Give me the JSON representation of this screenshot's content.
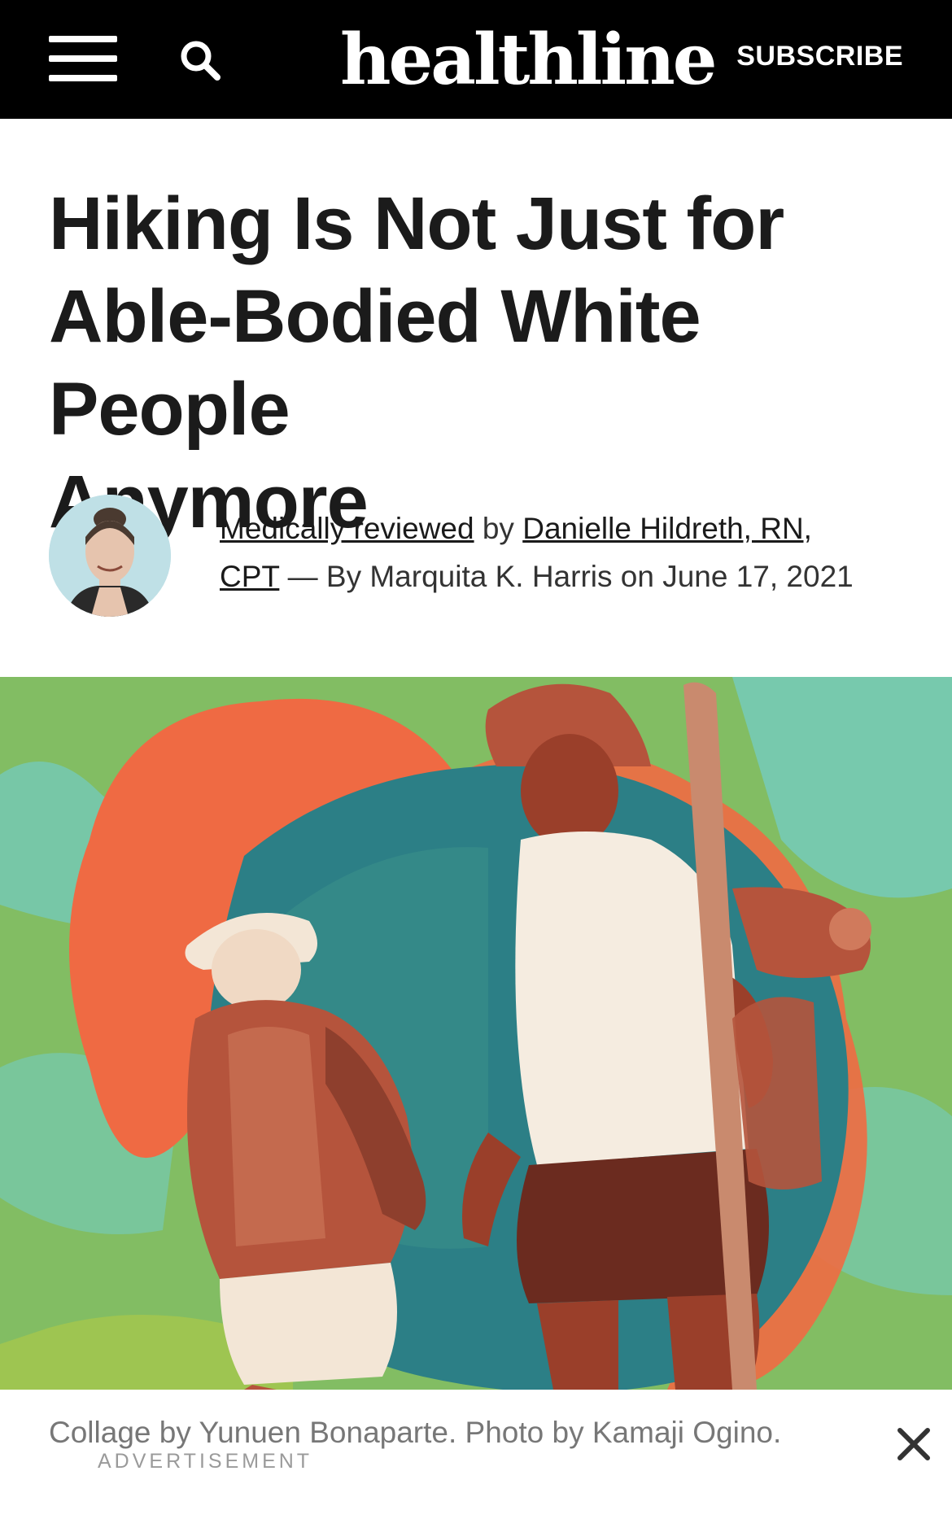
{
  "header": {
    "logo_text": "healthline",
    "subscribe_label": "SUBSCRIBE",
    "menu_icon": "hamburger-menu-icon",
    "search_icon": "search-icon"
  },
  "article": {
    "title_lines": [
      "Hiking Is Not Just for",
      "Able-Bodied White People",
      "Anymore"
    ],
    "byline": {
      "medically_reviewed": "Medically reviewed",
      "by": " by ",
      "reviewer_name": "Danielle Hildreth, RN,",
      "reviewer_cred": "CPT",
      "author_text": " — By Marquita K. Harris on June 17, 2021"
    },
    "hero_caption": "Collage by Yunuen Bonaparte. Photo by Kamaji Ogino."
  },
  "ad": {
    "label": "ADVERTISEMENT",
    "close_icon": "close-icon"
  },
  "colors": {
    "header_bg": "#000000",
    "text": "#1b1b1b",
    "hero_green": "#8bc26b",
    "hero_orange": "#ef6a43",
    "hero_teal": "#2c7f86",
    "hero_sky": "#6fd0e0",
    "figure_tone": "#b5543c"
  }
}
